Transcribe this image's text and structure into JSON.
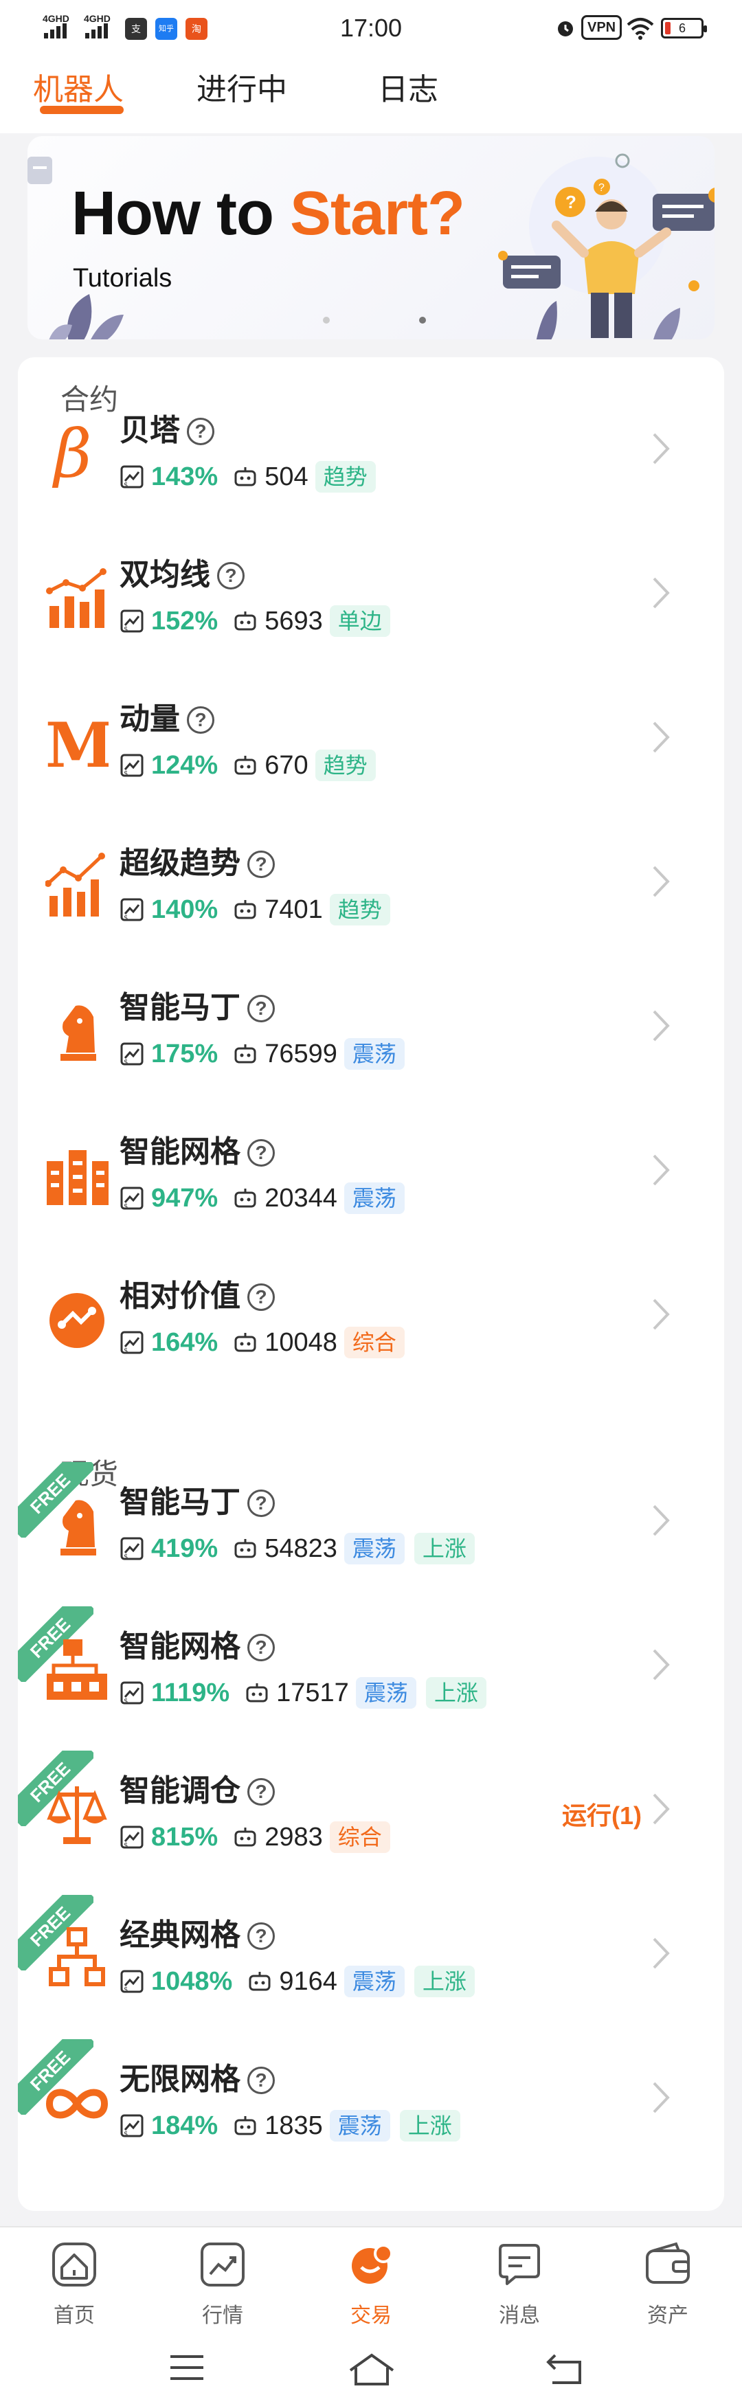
{
  "status_bar": {
    "time": "17:00",
    "left_items": [
      "4GHD",
      "4GHD"
    ],
    "app_icons": [
      "支",
      "知乎",
      "淘"
    ],
    "vpn_label": "VPN",
    "battery": "6"
  },
  "tabs": [
    {
      "label": "机器人",
      "active": true
    },
    {
      "label": "进行中",
      "active": false
    },
    {
      "label": "日志",
      "active": false
    }
  ],
  "banner": {
    "title_part1": "How to ",
    "title_part2": "Start?",
    "subtitle": "Tutorials"
  },
  "sections": {
    "contract": "合约",
    "spot": "现货"
  },
  "free_label": "FREE",
  "bots": [
    {
      "name": "贝塔",
      "pct": "143%",
      "count": "504",
      "tags": [
        {
          "text": "趋势",
          "style": "green"
        }
      ],
      "icon": "beta-icon"
    },
    {
      "name": "双均线",
      "pct": "152%",
      "count": "5693",
      "tags": [
        {
          "text": "单边",
          "style": "green"
        }
      ],
      "icon": "bar-chart-icon"
    },
    {
      "name": "动量",
      "pct": "124%",
      "count": "670",
      "tags": [
        {
          "text": "趋势",
          "style": "green"
        }
      ],
      "icon": "momentum-m-icon"
    },
    {
      "name": "超级趋势",
      "pct": "140%",
      "count": "7401",
      "tags": [
        {
          "text": "趋势",
          "style": "green"
        }
      ],
      "icon": "trend-chart-icon"
    },
    {
      "name": "智能马丁",
      "pct": "175%",
      "count": "76599",
      "tags": [
        {
          "text": "震荡",
          "style": "blue"
        }
      ],
      "icon": "chess-knight-icon"
    },
    {
      "name": "智能网格",
      "pct": "947%",
      "count": "20344",
      "tags": [
        {
          "text": "震荡",
          "style": "blue"
        }
      ],
      "icon": "grid-building-icon"
    },
    {
      "name": "相对价值",
      "pct": "164%",
      "count": "10048",
      "tags": [
        {
          "text": "综合",
          "style": "orange"
        }
      ],
      "icon": "relative-value-icon"
    },
    {
      "name": "智能马丁",
      "pct": "419%",
      "count": "54823",
      "tags": [
        {
          "text": "震荡",
          "style": "blue"
        },
        {
          "text": "上涨",
          "style": "green"
        }
      ],
      "icon": "chess-knight-icon",
      "free": true
    },
    {
      "name": "智能网格",
      "pct": "1119%",
      "count": "17517",
      "tags": [
        {
          "text": "震荡",
          "style": "blue"
        },
        {
          "text": "上涨",
          "style": "green"
        }
      ],
      "icon": "grid-tree-icon",
      "free": true
    },
    {
      "name": "智能调仓",
      "pct": "815%",
      "count": "2983",
      "tags": [
        {
          "text": "综合",
          "style": "orange"
        }
      ],
      "icon": "balance-scale-icon",
      "free": true,
      "running": "运行(1)"
    },
    {
      "name": "经典网格",
      "pct": "1048%",
      "count": "9164",
      "tags": [
        {
          "text": "震荡",
          "style": "blue"
        },
        {
          "text": "上涨",
          "style": "green"
        }
      ],
      "icon": "hierarchy-icon",
      "free": true
    },
    {
      "name": "无限网格",
      "pct": "184%",
      "count": "1835",
      "tags": [
        {
          "text": "震荡",
          "style": "blue"
        },
        {
          "text": "上涨",
          "style": "green"
        }
      ],
      "icon": "infinity-icon",
      "free": true
    }
  ],
  "bottom_nav": [
    {
      "label": "首页",
      "icon": "home-icon"
    },
    {
      "label": "行情",
      "icon": "market-chart-icon"
    },
    {
      "label": "交易",
      "icon": "trade-icon",
      "active": true
    },
    {
      "label": "消息",
      "icon": "message-icon"
    },
    {
      "label": "资产",
      "icon": "wallet-icon"
    }
  ],
  "colors": {
    "accent": "#f26a1b",
    "green": "#2db487",
    "blue": "#3c8ae0",
    "free_badge": "#52b788"
  }
}
